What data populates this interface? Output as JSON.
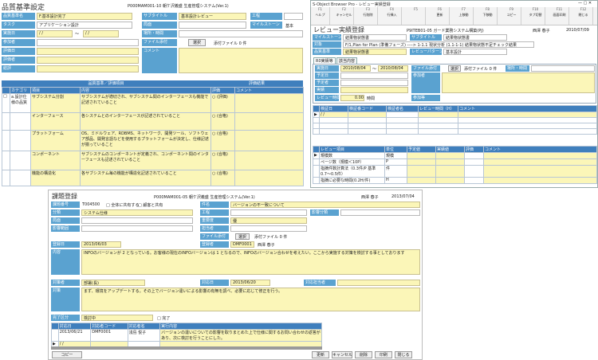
{
  "p1": {
    "title": "品質基準設定",
    "header_info": "P000MAM001-10 朝ケ沢義盛 生産管理システム(Ver.1)",
    "labels": {
      "standard_name": "品質基準名",
      "subtitle": "サブタイトル",
      "process": "工程",
      "task": "タスク",
      "phase": "局面",
      "milestone": "マイルストーン",
      "base": "基本",
      "period": "実施日",
      "location": "場所・時間",
      "participants": "参加者",
      "attachment": "ファイル添付",
      "evaluation_date": "評価日",
      "evaluator": "評価者",
      "comment": "コメント",
      "summary": "総評"
    },
    "values": {
      "standard_name": "F.基本設計完了",
      "subtitle": "基本設計レビュー",
      "task": "アプリケーション設計",
      "period_from": "/ /",
      "period_to": "/ /",
      "select": "選択",
      "attachment_count": "添付ファイル 0 件"
    },
    "table": {
      "group_header": "品質基準／評価項目",
      "group_header2": "評価結果",
      "columns": [
        "カテゴリ",
        "項目",
        "内容",
        "評価",
        "コメント"
      ],
      "rows": [
        {
          "category": "a.設計仕様の品質",
          "item": "サブシステム分割",
          "content": "サブシステムが適切され、サブシステム間のインターフェースも機能で記述されていること",
          "eval": "○ (評価)"
        },
        {
          "category": "",
          "item": "インターフェース",
          "content": "各システムとのインターフェースが記述されていること",
          "eval": "○ (合格)"
        },
        {
          "category": "",
          "item": "プラットフォーム",
          "content": "OS、ミドルウェア、RDBMS、ネットワーク、開発ツール、ソフトウェア部品、開発言語などを使用するプラットフォームが決定し、仕様記述が揃っていること",
          "eval": "○ (合格)"
        },
        {
          "category": "",
          "item": "コンポーネント",
          "content": "サブシステムのコンポーネントが定義され、コンポーネント間のインターフェースも記述されていること",
          "eval": "○ (合格)"
        },
        {
          "category": "",
          "item": "機能の構造化",
          "content": "各サブシステム毎の機能が構造化記述されていること",
          "eval": "○ (合格)"
        }
      ]
    }
  },
  "p2": {
    "window_title": "S-Object Browser Pro - レビュー実績登録",
    "toolbar": [
      {
        "key": "F1",
        "label": "ヘルプ"
      },
      {
        "key": "F2",
        "label": "キャンセル"
      },
      {
        "key": "F3",
        "label": "行削除"
      },
      {
        "key": "F4",
        "label": "行挿入"
      },
      {
        "key": "F5",
        "label": ""
      },
      {
        "key": "F6",
        "label": "更新"
      },
      {
        "key": "F7",
        "label": "上移動"
      },
      {
        "key": "F8",
        "label": "下移動"
      },
      {
        "key": "F9",
        "label": "コピー"
      },
      {
        "key": "F10",
        "label": "タブ切替"
      },
      {
        "key": "F11",
        "label": "画面印刷"
      },
      {
        "key": "F12",
        "label": "閉じる"
      }
    ],
    "title": "レビュー実績登録",
    "header_info": "P9ITEB01-05 ガード業務システム構築(PJ)",
    "user": "西澤 春子",
    "date": "2010/07/09",
    "labels": {
      "milestone": "マイルストーン",
      "subtitle": "サブタイトル",
      "target": "対象",
      "standard": "品質基準",
      "review_pattern": "レビューパターン",
      "tab1": "R0実績等",
      "tab2": "該当内容",
      "period": "実施日",
      "file": "ファイル添付",
      "location": "場所・時間",
      "planned_date": "予定日",
      "participants": "参加者",
      "scheduler": "予定者",
      "actual": "実績",
      "review_time": "レビュー時間",
      "hours": "時間",
      "attendee": "参加等"
    },
    "values": {
      "milestone": "結果物状態書",
      "subtitle": "結果物状態書",
      "target": "F/1,Plan for Plan (準備フェーズ) ----> 1-1.1 現状分析 (1.1-1-1) 結果物状態不足チェック結果",
      "standard": "結果物状態書",
      "review_pattern": "基本設計",
      "date_from": "2010/08/04",
      "date_to": "2010/08/04",
      "select": "選択",
      "attachment_count": "添付ファイル 0 件",
      "review_time": "0.00"
    },
    "grid1": {
      "columns": [
        "検証日",
        "検証番コード",
        "検証者名",
        "レビュー時間（H）",
        "コメント"
      ],
      "first_row": "/ /"
    },
    "grid2": {
      "columns": [
        "レビュー項目",
        "単位",
        "予定値",
        "実績値",
        "評価",
        "コメント"
      ],
      "rows": [
        {
          "item": "規模数",
          "unit": "規模"
        },
        {
          "item": "ページ数（規模＜10P）",
          "unit": "P"
        },
        {
          "item": "指摘件数計算法（0.3件/P 基準 0.7〜0.5件）",
          "unit": "件"
        },
        {
          "item": "指摘に必要な時間(0.2H/件)",
          "unit": "H"
        }
      ]
    }
  },
  "p3": {
    "title": "課題登録",
    "header_info": "P000MAM001-05 朝ケ沢義盛 生産管理システム(Ver.1)",
    "user": "西澤 春子",
    "date": "2013/07/04",
    "labels": {
      "issue_no": "課題番号",
      "issue_name": "件名",
      "category": "分類",
      "process": "工程",
      "severity": "影響分類",
      "phase": "局面",
      "importance": "重要度",
      "rank": "影響範囲",
      "owner": "担当者",
      "attachment": "ファイル添付",
      "register_date": "登録日",
      "registrant": "登録者",
      "content": "内容",
      "target": "対策者",
      "corrective": "対策",
      "answer_date": "対応日",
      "due_date": "対応期限",
      "responder": "対応担当者",
      "status": "完了区分",
      "done": "完了"
    },
    "values": {
      "issue_no": "T004500",
      "check1": "□ 全体に共有する",
      "check2": "□ 顧客と共有",
      "issue_name": "バージョンの不一致について",
      "category": "システム仕様",
      "priority": "優",
      "register_date": "2013/06/03",
      "registrant_code": "DMF0001",
      "registrant_name": "西澤 春子",
      "select": "選択",
      "attachment_count": "添付ファイル 0 件",
      "content": "INFOのバージョンが 2 となっている。お客様の現在のINFOバージョンは 1 となるので、INFOのバージョン合わせを考えたい。ここから実施する対策を検討する事としております",
      "target_owner": "部署(長)",
      "answer_date": "2013/06/20",
      "responder_code": "DMF0001",
      "responder_name": "西澤 春子",
      "corrective": "まず、環境をアップデートする。その上でバージョン違いによる影響の有無を調べ、必要に応じて修正を行う。",
      "status": "検討中"
    },
    "grid": {
      "columns": [
        "対応日",
        "対応者コード",
        "対応者名",
        "実行内容"
      ],
      "rows": [
        {
          "date": "2013/06/21",
          "code": "DMF0001",
          "name": "浅島 悦子",
          "detail": "バージョンの違いについての影響を取りまとめた上で仕様に関するお問い合わせの返答があり、次に検討を行うことにした。"
        },
        {
          "date": "/ /",
          "code": "",
          "name": "",
          "detail": ""
        }
      ]
    },
    "buttons": {
      "copy": "コピー",
      "update": "更新",
      "cancel": "キャンセル",
      "delete": "削除",
      "print": "印刷",
      "close": "閉じる"
    }
  }
}
